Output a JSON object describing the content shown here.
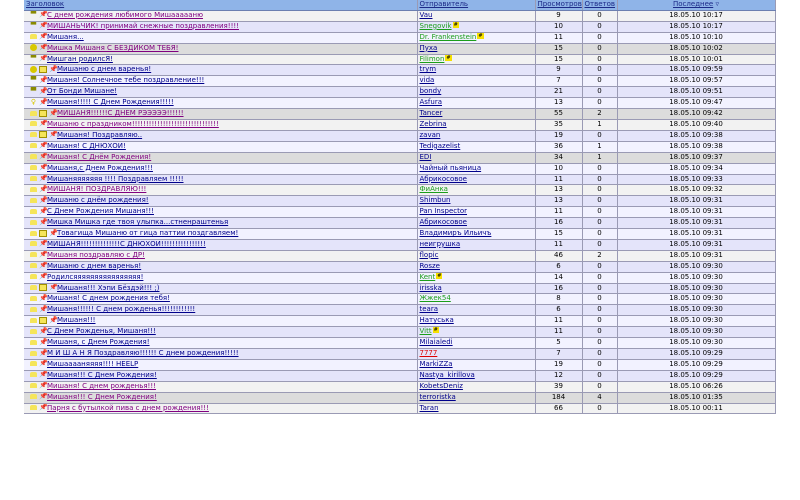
{
  "header": {
    "title": "Заголовок",
    "sender": "Отправитель",
    "views": "Просмотров",
    "replies": "Ответов",
    "last": "Последнее",
    "sort_icon": "▿"
  },
  "colors": {
    "header_bg": "#8fb4e8",
    "link": "#00008b",
    "visited": "#800080",
    "moderator": "#1b9e1b"
  },
  "rows": [
    {
      "title": "С днем рождения любимого Мишаааааню",
      "sender": "Vau",
      "views": "9",
      "replies": "0",
      "last": "18.05.10 10:17",
      "bg": "a",
      "icon": "thumb",
      "visited": true
    },
    {
      "title": "МИШАНЬЧИК! принимай снежные поздравления!!!!",
      "sender": "Snegovik",
      "views": "10",
      "replies": "0",
      "last": "18.05.10 10:17",
      "bg": "b",
      "icon": "thumb",
      "visited": true,
      "sc": "g",
      "badge": "#"
    },
    {
      "title": "Мишаня...",
      "sender": "Dr. Frankenstein",
      "views": "11",
      "replies": "0",
      "last": "18.05.10 10:10",
      "bg": "d",
      "icon": "lock",
      "sc": "g",
      "badge": "#"
    },
    {
      "title": "Мишка Мишаня С БЕЗДИКОМ ТЕБЯ!",
      "sender": "Пуха",
      "views": "15",
      "replies": "0",
      "last": "18.05.10 10:02",
      "bg": "c",
      "icon": "smile",
      "visited": true
    },
    {
      "title": "Мишган родилсЯ!",
      "sender": "Filimon",
      "views": "15",
      "replies": "0",
      "last": "18.05.10 10:01",
      "bg": "a",
      "icon": "thumb",
      "sc": "g",
      "badge": "#"
    },
    {
      "title": "Мишаню с днем варенья!",
      "sender": "trym",
      "views": "9",
      "replies": "0",
      "last": "18.05.10 09:59",
      "bg": "b",
      "icon": "smile",
      "new": true
    },
    {
      "title": "Мишаня! Солнечное тебе поздравление!!!",
      "sender": "vida",
      "views": "7",
      "replies": "0",
      "last": "18.05.10 09:57",
      "bg": "d",
      "icon": "thumb"
    },
    {
      "title": "От Бонди Мишане!",
      "sender": "bondy",
      "views": "21",
      "replies": "0",
      "last": "18.05.10 09:51",
      "bg": "b",
      "icon": "thumb"
    },
    {
      "title": "Мишаня!!!!! С Днем Рождения!!!!!",
      "sender": "Asfura",
      "views": "13",
      "replies": "0",
      "last": "18.05.10 09:47",
      "bg": "d",
      "icon": "bulb"
    },
    {
      "title": "МИШАНЯ!!!!!!С ДНЕМ РЭЭЭЭЭ!!!!!!",
      "sender": "Tancer",
      "views": "55",
      "replies": "2",
      "last": "18.05.10 09:42",
      "bg": "c",
      "icon": "lock",
      "new": true,
      "visited": true
    },
    {
      "title": "Мишаню с праздником!!!!!!!!!!!!!!!!!!!!!!!!!!!!!!!",
      "sender": "Zebrina",
      "views": "35",
      "replies": "1",
      "last": "18.05.10 09:40",
      "bg": "a",
      "icon": "lock",
      "visited": true
    },
    {
      "title": "Мишаня! Поздравляю..",
      "sender": "zavan",
      "views": "19",
      "replies": "0",
      "last": "18.05.10 09:38",
      "bg": "b",
      "icon": "lock",
      "new": true
    },
    {
      "title": "Мишаня! С ДНЮХОЙ!",
      "sender": "Tedigazelist",
      "views": "36",
      "replies": "1",
      "last": "18.05.10 09:38",
      "bg": "d",
      "icon": "lock"
    },
    {
      "title": "Мишаня! С Днём Рождения!",
      "sender": "EDI",
      "views": "34",
      "replies": "1",
      "last": "18.05.10 09:37",
      "bg": "c",
      "icon": "lock",
      "visited": true
    },
    {
      "title": "Мишаня,с Днем Рождения!!!",
      "sender": "Чайный пьяница",
      "views": "10",
      "replies": "0",
      "last": "18.05.10 09:34",
      "bg": "d",
      "icon": "lock"
    },
    {
      "title": "Мишаняяяяяяя !!!! Поздравляем !!!!!",
      "sender": "Абрикосовое",
      "views": "11",
      "replies": "0",
      "last": "18.05.10 09:33",
      "bg": "b",
      "icon": "lock"
    },
    {
      "title": "МИШАНЯ! ПОЗДРАВЛЯЮ!!!",
      "sender": "ФиАнка",
      "views": "13",
      "replies": "0",
      "last": "18.05.10 09:32",
      "bg": "a",
      "icon": "lock",
      "visited": true,
      "sc": "g"
    },
    {
      "title": "Мишаню с днём рождения!",
      "sender": "Shimbun",
      "views": "13",
      "replies": "0",
      "last": "18.05.10 09:31",
      "bg": "b",
      "icon": "lock"
    },
    {
      "title": "С Днем Рождения Мишаня!!!",
      "sender": "Pan Inspector",
      "views": "11",
      "replies": "0",
      "last": "18.05.10 09:31",
      "bg": "d",
      "icon": "lock"
    },
    {
      "title": "Мишка Мишка где твоя улыпка...стненраштенья",
      "sender": "Абрикосовое",
      "views": "16",
      "replies": "0",
      "last": "18.05.10 09:31",
      "bg": "b",
      "icon": "lock"
    },
    {
      "title": "Товагища Мишаню от гица паттии поздгавляем!",
      "sender": "Владимиръ Ильичъ",
      "views": "15",
      "replies": "0",
      "last": "18.05.10 09:31",
      "bg": "d",
      "icon": "lock",
      "new": true
    },
    {
      "title": "МИШАНЯ!!!!!!!!!!!!!!С ДНЮХОЙ!!!!!!!!!!!!!!!!",
      "sender": "неигрушка",
      "views": "11",
      "replies": "0",
      "last": "18.05.10 09:31",
      "bg": "b",
      "icon": "lock"
    },
    {
      "title": "Мишаня поздравляю с ДР!",
      "sender": "flopic",
      "views": "46",
      "replies": "2",
      "last": "18.05.10 09:31",
      "bg": "a",
      "icon": "lock",
      "visited": true
    },
    {
      "title": "Мишаню с днем варенья!",
      "sender": "Rosze",
      "views": "6",
      "replies": "0",
      "last": "18.05.10 09:30",
      "bg": "b",
      "icon": "lock"
    },
    {
      "title": "Родилсяяяяяяяяяяяяяяяя!",
      "sender": "Kent",
      "views": "14",
      "replies": "0",
      "last": "18.05.10 09:30",
      "bg": "d",
      "icon": "lock",
      "sc": "g",
      "badge": "#"
    },
    {
      "title": "Мишаня!!! Хэпи Бёздэй!!! ;)",
      "sender": "irisska",
      "views": "16",
      "replies": "0",
      "last": "18.05.10 09:30",
      "bg": "b",
      "icon": "lock",
      "new": true
    },
    {
      "title": "Мишаня! С днем рождения тебя!",
      "sender": "Жжек54",
      "views": "8",
      "replies": "0",
      "last": "18.05.10 09:30",
      "bg": "d",
      "icon": "lock",
      "sc": "g"
    },
    {
      "title": "Мишаня!!!!!! С днем рожденья!!!!!!!!!!!!",
      "sender": "teara",
      "views": "6",
      "replies": "0",
      "last": "18.05.10 09:30",
      "bg": "b",
      "icon": "lock"
    },
    {
      "title": "Мишаня!!!",
      "sender": "Натуська",
      "views": "11",
      "replies": "0",
      "last": "18.05.10 09:30",
      "bg": "d",
      "icon": "lock",
      "new": true
    },
    {
      "title": "С Днем Рожденья, Мишаня!!!",
      "sender": "Vitt",
      "views": "11",
      "replies": "0",
      "last": "18.05.10 09:30",
      "bg": "b",
      "icon": "lock",
      "sc": "g",
      "badge": "#"
    },
    {
      "title": "Мишаня, с Днем Рождения!",
      "sender": "Milaialedi",
      "views": "5",
      "replies": "0",
      "last": "18.05.10 09:30",
      "bg": "d",
      "icon": "lock"
    },
    {
      "title": "М И Ш А Н Я Поздравляю!!!!!! С днем рождения!!!!!",
      "sender": "7777",
      "views": "7",
      "replies": "0",
      "last": "18.05.10 09:29",
      "bg": "b",
      "icon": "lock",
      "sc": "r"
    },
    {
      "title": "Мишааааняяяя!!!! HEELP",
      "sender": "MarkiZZa",
      "views": "19",
      "replies": "0",
      "last": "18.05.10 09:29",
      "bg": "d",
      "icon": "lock"
    },
    {
      "title": "Мишаня!!! С Днем Рождения!",
      "sender": "Nastya_kirillova",
      "views": "12",
      "replies": "0",
      "last": "18.05.10 09:29",
      "bg": "b",
      "icon": "lock"
    },
    {
      "title": "Мишаня! С днем рожденья!!!",
      "sender": "KobetsDeniz",
      "views": "39",
      "replies": "0",
      "last": "18.05.10 06:26",
      "bg": "a",
      "icon": "lock",
      "visited": true
    },
    {
      "title": "Мишаня!!! С Днем Рождения!",
      "sender": "terroristka",
      "views": "184",
      "replies": "4",
      "last": "18.05.10 01:35",
      "bg": "c",
      "icon": "lock",
      "visited": true
    },
    {
      "title": "Парня с бутылкой пива с днем рождения!!!",
      "sender": "Taran",
      "views": "66",
      "replies": "0",
      "last": "18.05.10 00:11",
      "bg": "a",
      "icon": "lock",
      "visited": true
    }
  ]
}
